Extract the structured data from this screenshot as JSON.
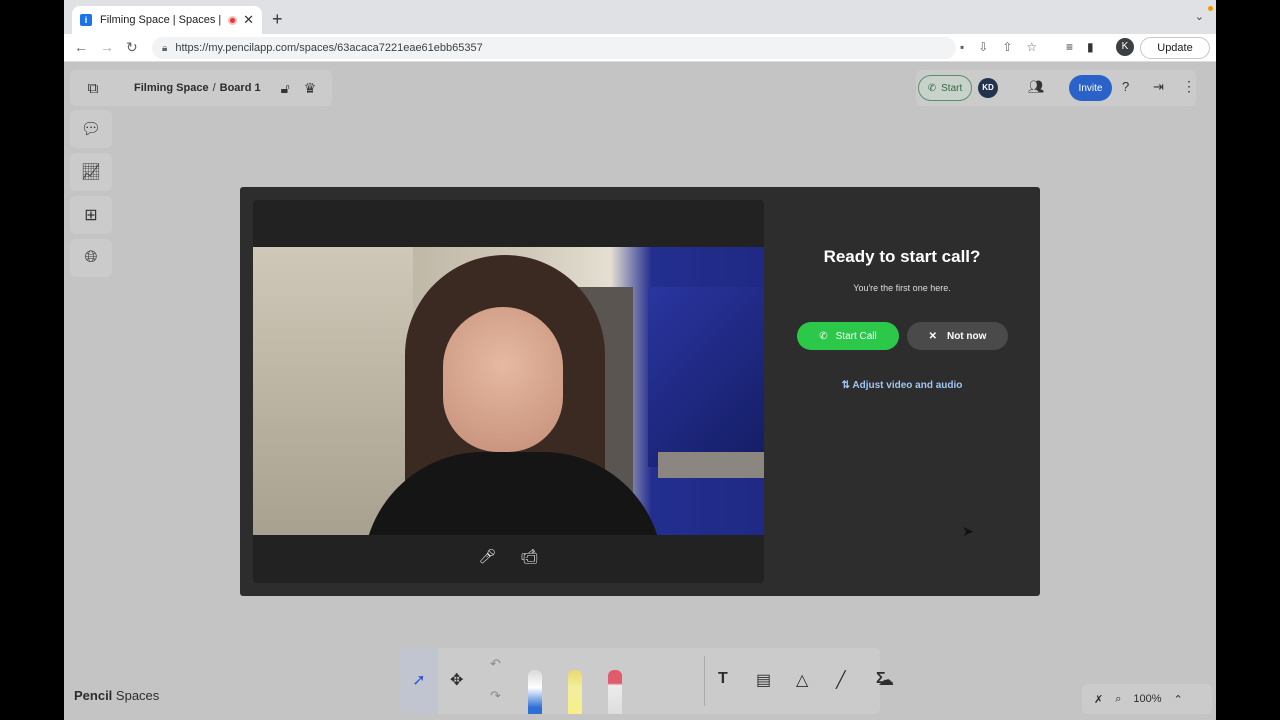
{
  "browser": {
    "tab_title": "Filming Space | Spaces | Pe",
    "url": "https://my.pencilapp.com/spaces/63acaca7221eae61ebb65357",
    "profile_initial": "K",
    "update_label": "Update"
  },
  "header": {
    "space_name": "Filming Space",
    "separator": "/",
    "board_name": "Board 1",
    "start_label": "Start",
    "user_initials": "KD",
    "invite_label": "Invite"
  },
  "modal": {
    "title": "Ready to start call?",
    "subtitle": "You're the first one here.",
    "start_call_label": "Start Call",
    "not_now_label": "Not now",
    "adjust_label": "Adjust video and audio"
  },
  "footer": {
    "brand_bold": "Pencil",
    "brand_rest": "Spaces",
    "zoom": "100%"
  },
  "colors": {
    "accent_green": "#2cc84a",
    "invite_blue": "#2a62c9",
    "modal_bg": "#2d2d2d"
  }
}
